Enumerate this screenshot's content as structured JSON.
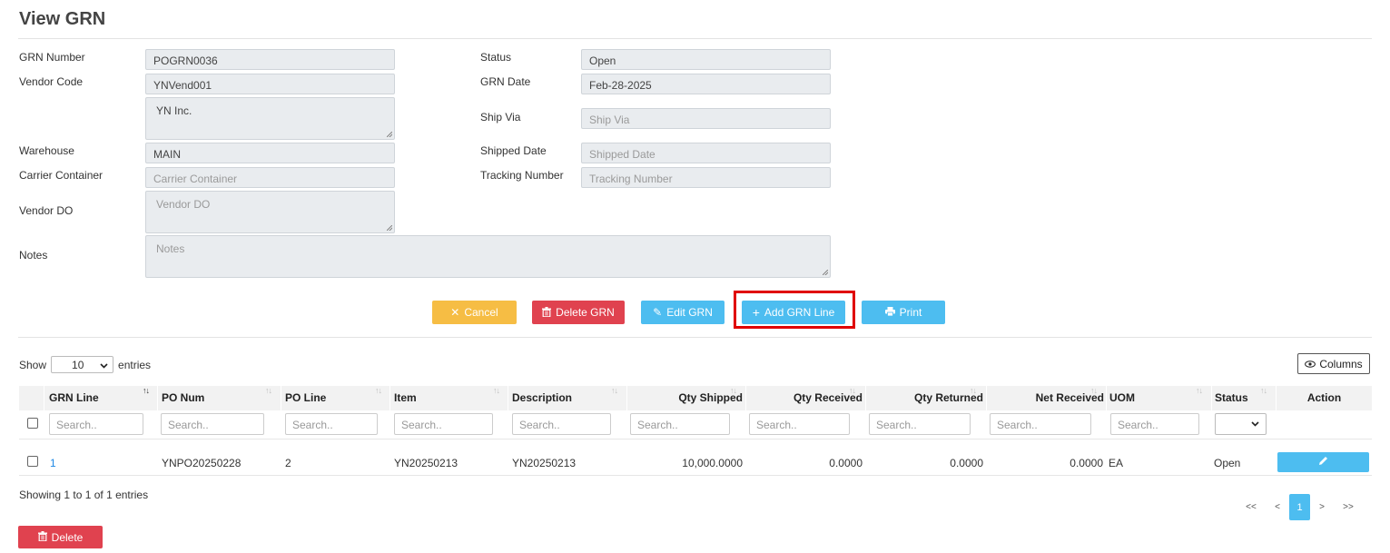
{
  "page": {
    "title": "View GRN"
  },
  "form": {
    "grn_number": {
      "label": "GRN Number",
      "value": "POGRN0036"
    },
    "vendor_code": {
      "label": "Vendor Code",
      "value": "YNVend001"
    },
    "vendor_name": {
      "value": "YN Inc."
    },
    "warehouse": {
      "label": "Warehouse",
      "value": "MAIN"
    },
    "carrier_container": {
      "label": "Carrier Container",
      "placeholder": "Carrier Container"
    },
    "vendor_do": {
      "label": "Vendor DO",
      "placeholder": "Vendor DO"
    },
    "notes": {
      "label": "Notes",
      "placeholder": "Notes"
    },
    "status": {
      "label": "Status",
      "value": "Open"
    },
    "grn_date": {
      "label": "GRN Date",
      "value": "Feb-28-2025"
    },
    "ship_via": {
      "label": "Ship Via",
      "placeholder": "Ship Via"
    },
    "shipped_date": {
      "label": "Shipped Date",
      "placeholder": "Shipped Date"
    },
    "tracking_number": {
      "label": "Tracking Number",
      "placeholder": "Tracking Number"
    }
  },
  "actions": {
    "cancel": "Cancel",
    "delete_grn": "Delete GRN",
    "edit_grn": "Edit GRN",
    "add_grn_line": "Add GRN Line",
    "print": "Print"
  },
  "table": {
    "show_label": "Show",
    "entries_label": "entries",
    "page_length": "10",
    "columns_button": "Columns",
    "search_placeholder": "Search..",
    "headers": {
      "grn_line": "GRN Line",
      "po_num": "PO Num",
      "po_line": "PO Line",
      "item": "Item",
      "description": "Description",
      "qty_shipped": "Qty Shipped",
      "qty_received": "Qty Received",
      "qty_returned": "Qty Returned",
      "net_received": "Net Received",
      "uom": "UOM",
      "status": "Status",
      "action": "Action"
    },
    "rows": [
      {
        "grn_line": "1",
        "po_num": "YNPO20250228",
        "po_line": "2",
        "item": "YN20250213",
        "description": "YN20250213",
        "qty_shipped": "10,000.0000",
        "qty_received": "0.0000",
        "qty_returned": "0.0000",
        "net_received": "0.0000",
        "uom": "EA",
        "status": "Open"
      }
    ],
    "info": "Showing 1 to 1 of 1 entries",
    "pagination": {
      "first": "<<",
      "prev": "<",
      "current": "1",
      "next": ">",
      "last": ">>"
    },
    "delete_button": "Delete"
  },
  "colors": {
    "cancel": "#f6bd44",
    "danger": "#e0424f",
    "info": "#4dbdf0",
    "highlight_border": "#e00000",
    "link": "#1e88e5"
  },
  "icons": {
    "cancel": "close-icon",
    "delete_grn": "trash-icon",
    "edit_grn": "pencil-icon",
    "add_grn_line": "plus-icon",
    "print": "print-icon",
    "columns": "eye-icon",
    "row_edit": "pencil-icon"
  }
}
